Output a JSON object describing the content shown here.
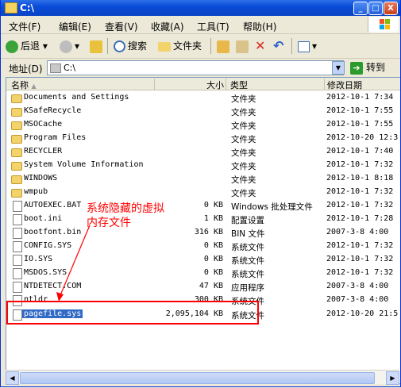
{
  "window": {
    "title": "C:\\",
    "minimize": "_",
    "maximize": "□",
    "close": "X"
  },
  "menu": [
    "文件(F)",
    "编辑(E)",
    "查看(V)",
    "收藏(A)",
    "工具(T)",
    "帮助(H)"
  ],
  "toolbar": {
    "back": "后退",
    "search": "搜索",
    "folders": "文件夹"
  },
  "address": {
    "label": "地址(D)",
    "value": "C:\\",
    "go": "转到"
  },
  "columns": {
    "name": "名称",
    "size": "大小",
    "type": "类型",
    "date": "修改日期"
  },
  "files": [
    {
      "name": "Documents and Settings",
      "size": "",
      "type": "文件夹",
      "date": "2012-10-1 7:34",
      "kind": "folder"
    },
    {
      "name": "KSafeRecycle",
      "size": "",
      "type": "文件夹",
      "date": "2012-10-1 7:55",
      "kind": "folder"
    },
    {
      "name": "MSOCache",
      "size": "",
      "type": "文件夹",
      "date": "2012-10-1 7:55",
      "kind": "folder"
    },
    {
      "name": "Program Files",
      "size": "",
      "type": "文件夹",
      "date": "2012-10-20 12:3",
      "kind": "folder"
    },
    {
      "name": "RECYCLER",
      "size": "",
      "type": "文件夹",
      "date": "2012-10-1 7:40",
      "kind": "folder"
    },
    {
      "name": "System Volume Information",
      "size": "",
      "type": "文件夹",
      "date": "2012-10-1 7:32",
      "kind": "folder"
    },
    {
      "name": "WINDOWS",
      "size": "",
      "type": "文件夹",
      "date": "2012-10-1 8:18",
      "kind": "folder"
    },
    {
      "name": "wmpub",
      "size": "",
      "type": "文件夹",
      "date": "2012-10-1 7:32",
      "kind": "folder"
    },
    {
      "name": "AUTOEXEC.BAT",
      "size": "0 KB",
      "type": "Windows 批处理文件",
      "date": "2012-10-1 7:32",
      "kind": "file"
    },
    {
      "name": "boot.ini",
      "size": "1 KB",
      "type": "配置设置",
      "date": "2012-10-1 7:28",
      "kind": "file"
    },
    {
      "name": "bootfont.bin",
      "size": "316 KB",
      "type": "BIN 文件",
      "date": "2007-3-8 4:00",
      "kind": "file"
    },
    {
      "name": "CONFIG.SYS",
      "size": "0 KB",
      "type": "系统文件",
      "date": "2012-10-1 7:32",
      "kind": "file"
    },
    {
      "name": "IO.SYS",
      "size": "0 KB",
      "type": "系统文件",
      "date": "2012-10-1 7:32",
      "kind": "file"
    },
    {
      "name": "MSDOS.SYS",
      "size": "0 KB",
      "type": "系统文件",
      "date": "2012-10-1 7:32",
      "kind": "file"
    },
    {
      "name": "NTDETECT.COM",
      "size": "47 KB",
      "type": "应用程序",
      "date": "2007-3-8 4:00",
      "kind": "file"
    },
    {
      "name": "ntldr",
      "size": "300 KB",
      "type": "系统文件",
      "date": "2007-3-8 4:00",
      "kind": "file"
    },
    {
      "name": "pagefile.sys",
      "size": "2,095,104 KB",
      "type": "系统文件",
      "date": "2012-10-20 21:5",
      "kind": "file",
      "selected": true
    }
  ],
  "annotation": {
    "line1": "系统隐藏的虚拟",
    "line2": "内存文件",
    "color": "#ff0000"
  }
}
